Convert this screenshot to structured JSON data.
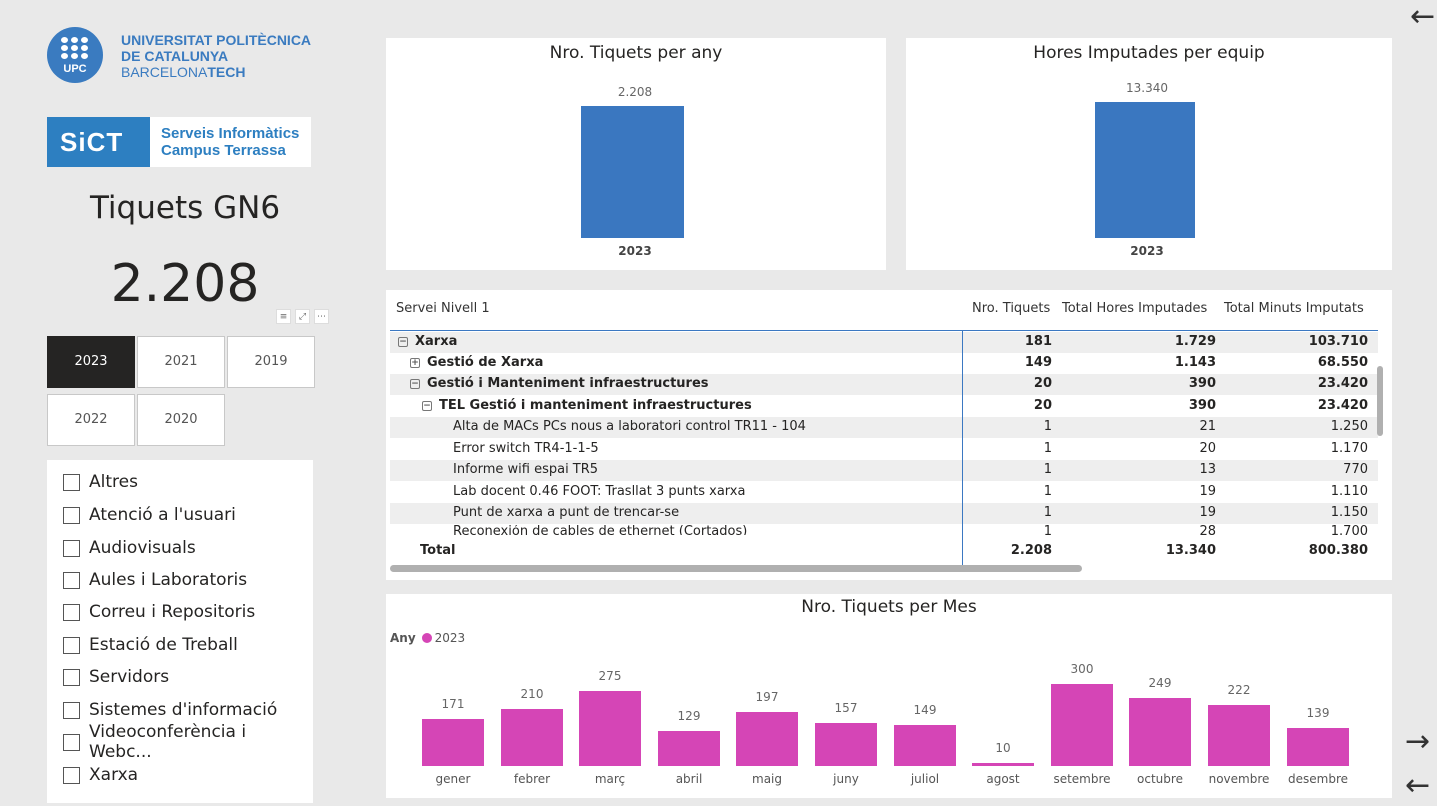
{
  "branding": {
    "upc_circle": "UPC",
    "upc_line1": "UNIVERSITAT POLITÈCNICA",
    "upc_line2": "DE CATALUNYA",
    "upc_line3a": "BARCELONA",
    "upc_line3b": "TECH",
    "sict_mark": "SiCT",
    "sict_line1": "Serveis Informàtics",
    "sict_line2": "Campus Terrassa",
    "primary_color": "#3a7bc0"
  },
  "kpi": {
    "title": "Tiquets GN6",
    "value": "2.208"
  },
  "year_slicer": {
    "items": [
      {
        "label": "2023",
        "selected": true
      },
      {
        "label": "2021",
        "selected": false
      },
      {
        "label": "2019",
        "selected": false
      },
      {
        "label": "2022",
        "selected": false
      },
      {
        "label": "2020",
        "selected": false
      }
    ]
  },
  "service_slicer": {
    "items": [
      {
        "label": "Altres",
        "checked": false
      },
      {
        "label": "Atenció a l'usuari",
        "checked": false
      },
      {
        "label": "Audiovisuals",
        "checked": false
      },
      {
        "label": "Aules i Laboratoris",
        "checked": false
      },
      {
        "label": "Correu i Repositoris",
        "checked": false
      },
      {
        "label": "Estació de Treball",
        "checked": false
      },
      {
        "label": "Servidors",
        "checked": false
      },
      {
        "label": "Sistemes d'informació",
        "checked": false
      },
      {
        "label": "Videoconferència i Webc...",
        "checked": false
      },
      {
        "label": "Xarxa",
        "checked": false
      }
    ]
  },
  "visual_header_icons": [
    "filter-icon",
    "focus-mode-icon",
    "more-options-icon"
  ],
  "cards": {
    "tickets_year": {
      "title": "Nro. Tiquets per any",
      "value_label": "2.208",
      "category": "2023",
      "color": "#3a77c0"
    },
    "hours_team": {
      "title": "Hores Imputades per equip",
      "value_label": "13.340",
      "category": "2023",
      "color": "#3a77c0"
    }
  },
  "matrix": {
    "headers": [
      "Servei Nivell 1",
      "Nro. Tiquets",
      "Total Hores Imputades",
      "Total Minuts Imputats"
    ],
    "rows": [
      {
        "label": "Xarxa",
        "expander": "⊟",
        "tickets": "181",
        "hours": "1.729",
        "minutes": "103.710",
        "bold": true,
        "shade": true
      },
      {
        "label": "Gestió de Xarxa",
        "expander": "⊞",
        "tickets": "149",
        "hours": "1.143",
        "minutes": "68.550",
        "bold": true,
        "shade": false
      },
      {
        "label": "Gestió i Manteniment infraestructures",
        "expander": "⊟",
        "tickets": "20",
        "hours": "390",
        "minutes": "23.420",
        "bold": true,
        "shade": true
      },
      {
        "label": "TEL Gestió i manteniment infraestructures",
        "expander": "⊟",
        "tickets": "20",
        "hours": "390",
        "minutes": "23.420",
        "bold": true,
        "shade": false
      },
      {
        "label": "Alta de MACs PCs nous a laboratori control TR11 - 104",
        "expander": "",
        "tickets": "1",
        "hours": "21",
        "minutes": "1.250",
        "bold": false,
        "shade": true
      },
      {
        "label": "Error switch TR4-1-1-5",
        "expander": "",
        "tickets": "1",
        "hours": "20",
        "minutes": "1.170",
        "bold": false,
        "shade": false
      },
      {
        "label": "Informe wifi espai TR5",
        "expander": "",
        "tickets": "1",
        "hours": "13",
        "minutes": "770",
        "bold": false,
        "shade": true
      },
      {
        "label": "Lab docent 0.46 FOOT: Trasllat 3 punts xarxa",
        "expander": "",
        "tickets": "1",
        "hours": "19",
        "minutes": "1.110",
        "bold": false,
        "shade": false
      },
      {
        "label": "Punt de xarxa a punt de trencar-se",
        "expander": "",
        "tickets": "1",
        "hours": "19",
        "minutes": "1.150",
        "bold": false,
        "shade": true
      },
      {
        "label": "Reconexión de cables de ethernet (Cortados)",
        "expander": "",
        "tickets": "1",
        "hours": "28",
        "minutes": "1.700",
        "bold": false,
        "shade": false
      }
    ],
    "total": {
      "label": "Total",
      "tickets": "2.208",
      "hours": "13.340",
      "minutes": "800.380"
    },
    "separator_color": "#3b78c2"
  },
  "chart_data": {
    "type": "bar",
    "title": "Nro. Tiquets per Mes",
    "legend_title": "Any",
    "series": [
      {
        "name": "2023",
        "color": "#d545b6",
        "values": [
          171,
          210,
          275,
          129,
          197,
          157,
          149,
          10,
          300,
          249,
          222,
          139
        ]
      }
    ],
    "categories": [
      "gener",
      "febrer",
      "març",
      "abril",
      "maig",
      "juny",
      "juliol",
      "agost",
      "setembre",
      "octubre",
      "novembre",
      "desembre"
    ],
    "ylim": [
      0,
      300
    ],
    "grid": false,
    "legend_position": "top-left"
  },
  "navigation": {
    "back_arrow": "←",
    "next_arrow": "→",
    "prev_arrow": "←"
  }
}
